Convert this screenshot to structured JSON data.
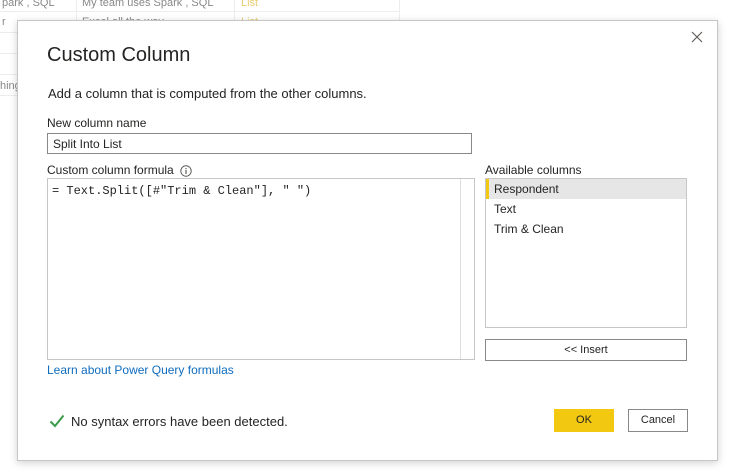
{
  "background_table": {
    "rows": [
      {
        "col1": "park , SQL",
        "col2": "My team uses Spark , SQL",
        "col3": "List"
      },
      {
        "col1": "r",
        "col2": "Excel all the way",
        "col3": "List"
      },
      {
        "col1": "",
        "col2": "",
        "col3": ""
      },
      {
        "col1": "hing",
        "col2": "",
        "col3": ""
      }
    ]
  },
  "dialog": {
    "title": "Custom Column",
    "subtitle": "Add a column that is computed from the other columns.",
    "close_icon": "close-icon",
    "new_column_label": "New column name",
    "new_column_value": "Split Into List",
    "formula_label": "Custom column formula",
    "formula_info_icon": "info-icon",
    "formula_value": "= Text.Split([#\"Trim & Clean\"], \" \")",
    "available_label": "Available columns",
    "available_columns": [
      "Respondent",
      "Text",
      "Trim & Clean"
    ],
    "selected_column": "Respondent",
    "insert_label": "<< Insert",
    "learn_link": "Learn about Power Query formulas",
    "status_icon": "checkmark-icon",
    "status_text": "No syntax errors have been detected.",
    "ok_label": "OK",
    "cancel_label": "Cancel"
  },
  "colors": {
    "accent": "#f2c811",
    "link": "#0f6cbd",
    "success": "#3a9b4a",
    "list_text": "#d6a400"
  }
}
